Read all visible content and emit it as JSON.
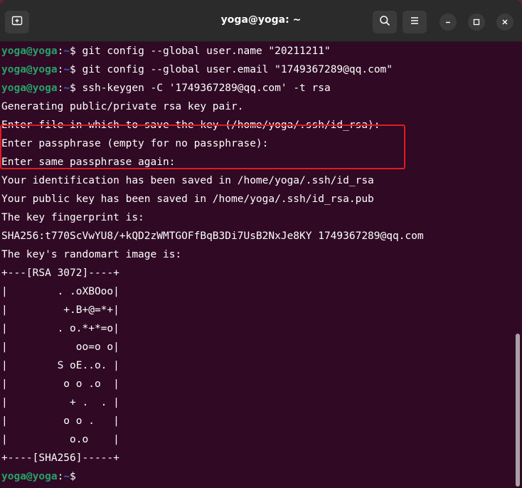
{
  "window": {
    "title": "yoga@yoga: ~"
  },
  "icons": {
    "new_tab": "new-tab-icon",
    "search": "search-icon",
    "menu": "hamburger-menu-icon",
    "minimize": "minimize-icon",
    "maximize": "maximize-icon",
    "close": "close-icon"
  },
  "colors": {
    "terminal_bg": "#300a24",
    "prompt_user": "#26a269",
    "prompt_path": "#3b62c9",
    "highlight_box": "#e01b24"
  },
  "prompt": {
    "user": "yoga@yoga",
    "sep": ":",
    "path": "~",
    "symbol": "$ "
  },
  "lines": [
    {
      "type": "cmd",
      "text": "git config --global user.name \"20211211\""
    },
    {
      "type": "cmd",
      "text": "git config --global user.email \"1749367289@qq.com\""
    },
    {
      "type": "cmd",
      "text": "ssh-keygen -C '1749367289@qq.com' -t rsa"
    },
    {
      "type": "out",
      "text": "Generating public/private rsa key pair."
    },
    {
      "type": "out",
      "text": "Enter file in which to save the key (/home/yoga/.ssh/id_rsa):"
    },
    {
      "type": "out",
      "text": "Enter passphrase (empty for no passphrase):"
    },
    {
      "type": "out",
      "text": "Enter same passphrase again:"
    },
    {
      "type": "out",
      "text": "Your identification has been saved in /home/yoga/.ssh/id_rsa"
    },
    {
      "type": "out",
      "text": "Your public key has been saved in /home/yoga/.ssh/id_rsa.pub"
    },
    {
      "type": "out",
      "text": "The key fingerprint is:"
    },
    {
      "type": "out",
      "text": "SHA256:t770ScVwYU8/+kQD2zWMTGOFfBqB3Di7UsB2NxJe8KY 1749367289@qq.com"
    },
    {
      "type": "out",
      "text": "The key's randomart image is:"
    },
    {
      "type": "out",
      "text": "+---[RSA 3072]----+"
    },
    {
      "type": "out",
      "text": "|        . .oXBOoo|"
    },
    {
      "type": "out",
      "text": "|         +.B+@=*+|"
    },
    {
      "type": "out",
      "text": "|        . o.*+*=o|"
    },
    {
      "type": "out",
      "text": "|           oo=o o|"
    },
    {
      "type": "out",
      "text": "|        S oE..o. |"
    },
    {
      "type": "out",
      "text": "|         o o .o  |"
    },
    {
      "type": "out",
      "text": "|          + .  . |"
    },
    {
      "type": "out",
      "text": "|         o o .   |"
    },
    {
      "type": "out",
      "text": "|          o.o    |"
    },
    {
      "type": "out",
      "text": "+----[SHA256]-----+"
    },
    {
      "type": "cmd",
      "text": ""
    }
  ]
}
